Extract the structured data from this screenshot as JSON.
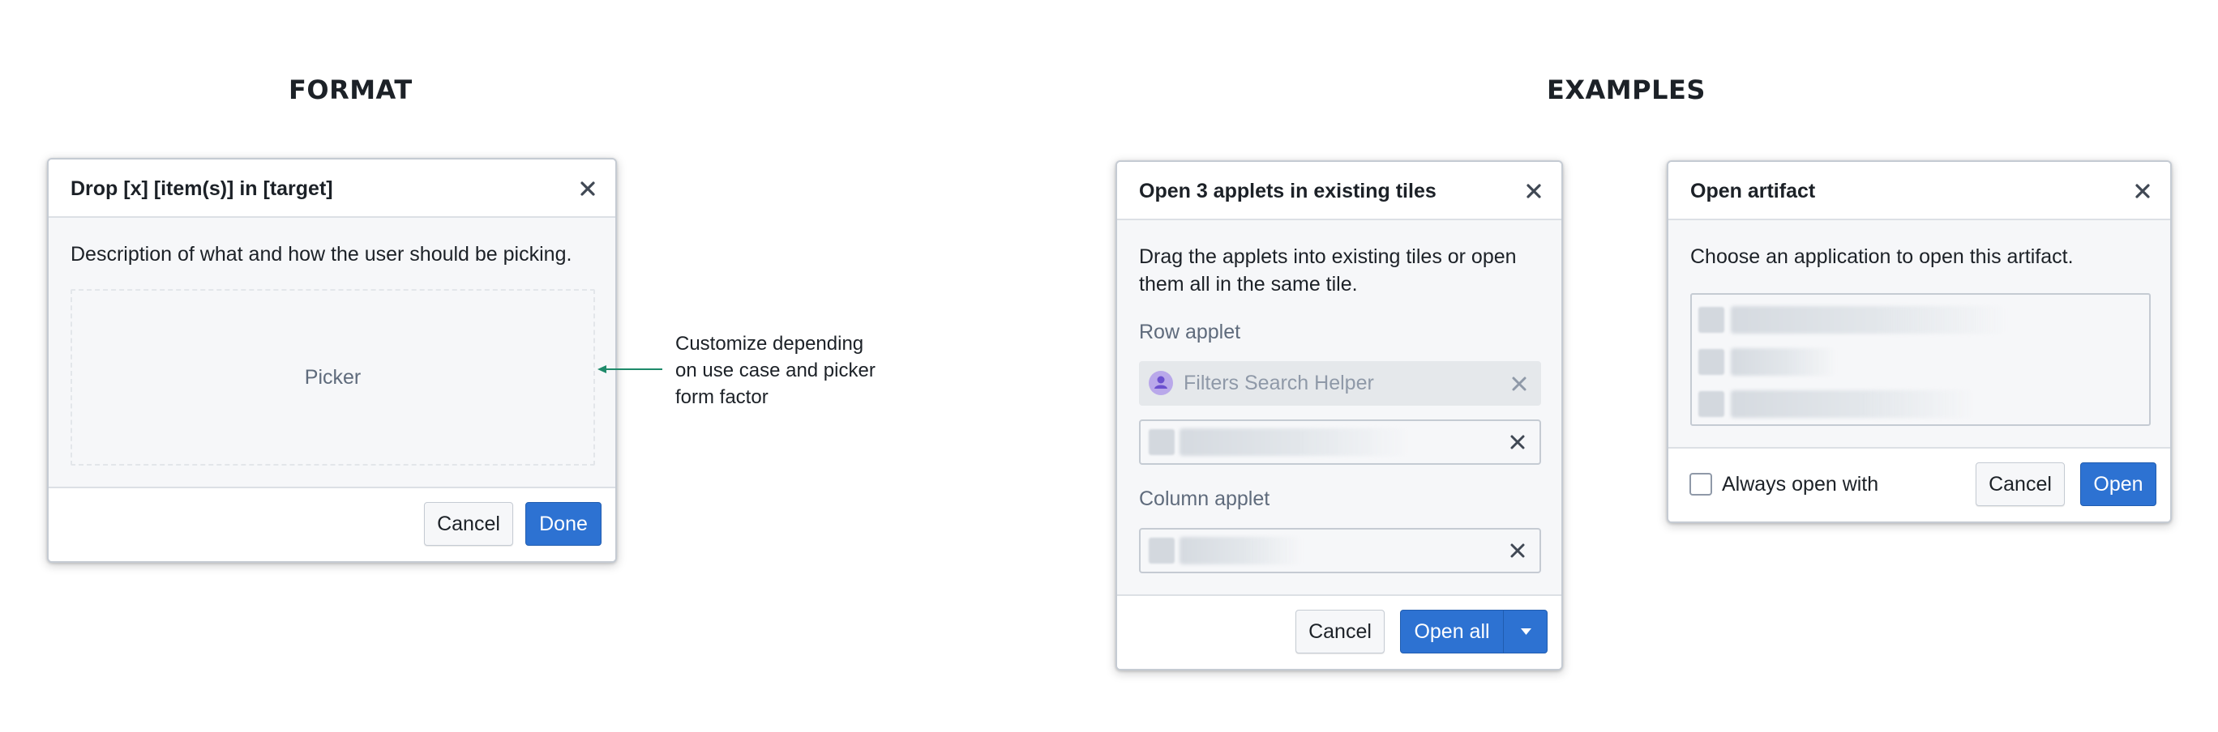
{
  "sections": {
    "format_title": "FORMAT",
    "examples_title": "EXAMPLES"
  },
  "format_dialog": {
    "title": "Drop [x] [item(s)] in [target]",
    "description": "Description of what and how the user should be picking.",
    "picker_label": "Picker",
    "cancel_label": "Cancel",
    "done_label": "Done"
  },
  "annotation": {
    "text": "Customize depending on use case and picker form factor",
    "color": "#1e8a6a"
  },
  "open_applets_dialog": {
    "title": "Open 3 applets in existing tiles",
    "description": "Drag the applets into existing tiles or open them all in the same tile.",
    "row_applet_label": "Row applet",
    "row_applet_placeholder": "Filters Search Helper",
    "column_applet_label": "Column applet",
    "cancel_label": "Cancel",
    "open_all_label": "Open all"
  },
  "open_artifact_dialog": {
    "title": "Open artifact",
    "description": "Choose an application to open this artifact.",
    "always_open_label": "Always open with",
    "cancel_label": "Cancel",
    "open_label": "Open"
  },
  "colors": {
    "primary": "#2d72d2",
    "border": "#c5cbd3",
    "background": "#f6f7f9"
  }
}
